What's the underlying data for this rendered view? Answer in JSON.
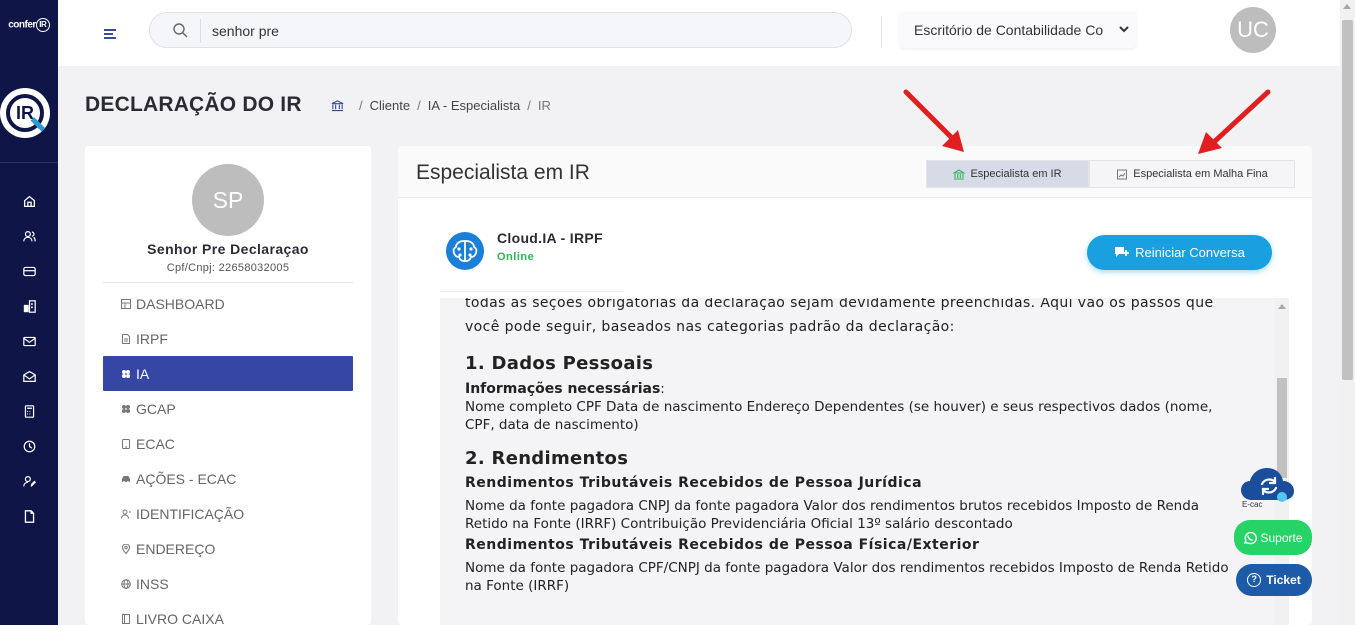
{
  "rail": {
    "brand_small": "confer",
    "brand_small_ir": "IR",
    "brand_big": "IR",
    "icons": [
      "home-icon",
      "users-icon",
      "card-icon",
      "building-icon",
      "mail-icon",
      "mail-open-icon",
      "calculator-icon",
      "clock-icon",
      "user-edit-icon",
      "file-icon"
    ]
  },
  "topbar": {
    "search_value": "senhor pre",
    "office_select": "Escritório de Contabilidade Co",
    "user_initials": "UC"
  },
  "page": {
    "title": "DECLARAÇÃO DO IR",
    "breadcrumb": [
      "Cliente",
      "IA - Especialista",
      "IR"
    ]
  },
  "client": {
    "initials": "SP",
    "name": "Senhor Pre Declaraçao",
    "doc": "Cpf/Cnpj: 22658032005",
    "menu": [
      {
        "label": "DASHBOARD",
        "icon": "dashboard-icon"
      },
      {
        "label": "IRPF",
        "icon": "file-icon"
      },
      {
        "label": "IA",
        "icon": "ai-icon",
        "active": true
      },
      {
        "label": "GCAP",
        "icon": "gcap-icon"
      },
      {
        "label": "ECAC",
        "icon": "tablet-icon"
      },
      {
        "label": "AÇÕES - ECAC",
        "icon": "car-icon"
      },
      {
        "label": "IDENTIFICAÇÃO",
        "icon": "user-icon"
      },
      {
        "label": "ENDEREÇO",
        "icon": "location-icon"
      },
      {
        "label": "INSS",
        "icon": "globe-icon"
      },
      {
        "label": "LIVRO CAIXA",
        "icon": "book-icon"
      }
    ]
  },
  "panel": {
    "title": "Especialista em IR",
    "tabs": [
      "Especialista em IR",
      "Especialista em Malha Fina"
    ],
    "bot_name": "Cloud.IA - IRPF",
    "bot_status": "Online",
    "restart_label": "Reiniciar Conversa"
  },
  "chat": {
    "intro": "todas as seções obrigatórias da declaração sejam devidamente preenchidas. Aqui vão os passos que você pode seguir, baseados nas categorias padrão da declaração:",
    "s1_title": "1. Dados Pessoais",
    "s1_label": "Informações necessárias",
    "s1_colon": ":",
    "s1_text": "Nome completo CPF Data de nascimento Endereço Dependentes (se houver) e seus respectivos dados (nome, CPF, data de nascimento)",
    "s2_title": "2. Rendimentos",
    "s2_sub1": "Rendimentos Tributáveis Recebidos de Pessoa Jurídica",
    "s2_text1": "Nome da fonte pagadora CNPJ da fonte pagadora Valor dos rendimentos brutos recebidos Imposto de Renda Retido na Fonte (IRRF) Contribuição Previdenciária Oficial 13º salário descontado",
    "s2_sub2": "Rendimentos Tributáveis Recebidos de Pessoa Física/Exterior",
    "s2_text2": "Nome da fonte pagadora CPF/CNPJ da fonte pagadora Valor dos rendimentos recebidos Imposto de Renda Retido na Fonte (IRRF)"
  },
  "widgets": {
    "ecac_label": "E-cac",
    "suporte": "Suporte",
    "ticket": "Ticket",
    "ticket_icon": "?"
  },
  "colors": {
    "rail": "#0f1547",
    "active_menu": "#3646a4",
    "restart_button": "#1a9fe0",
    "online": "#2eb352",
    "suporte": "#25d366",
    "ticket": "#1d5ba8",
    "arrow": "#e02020"
  }
}
